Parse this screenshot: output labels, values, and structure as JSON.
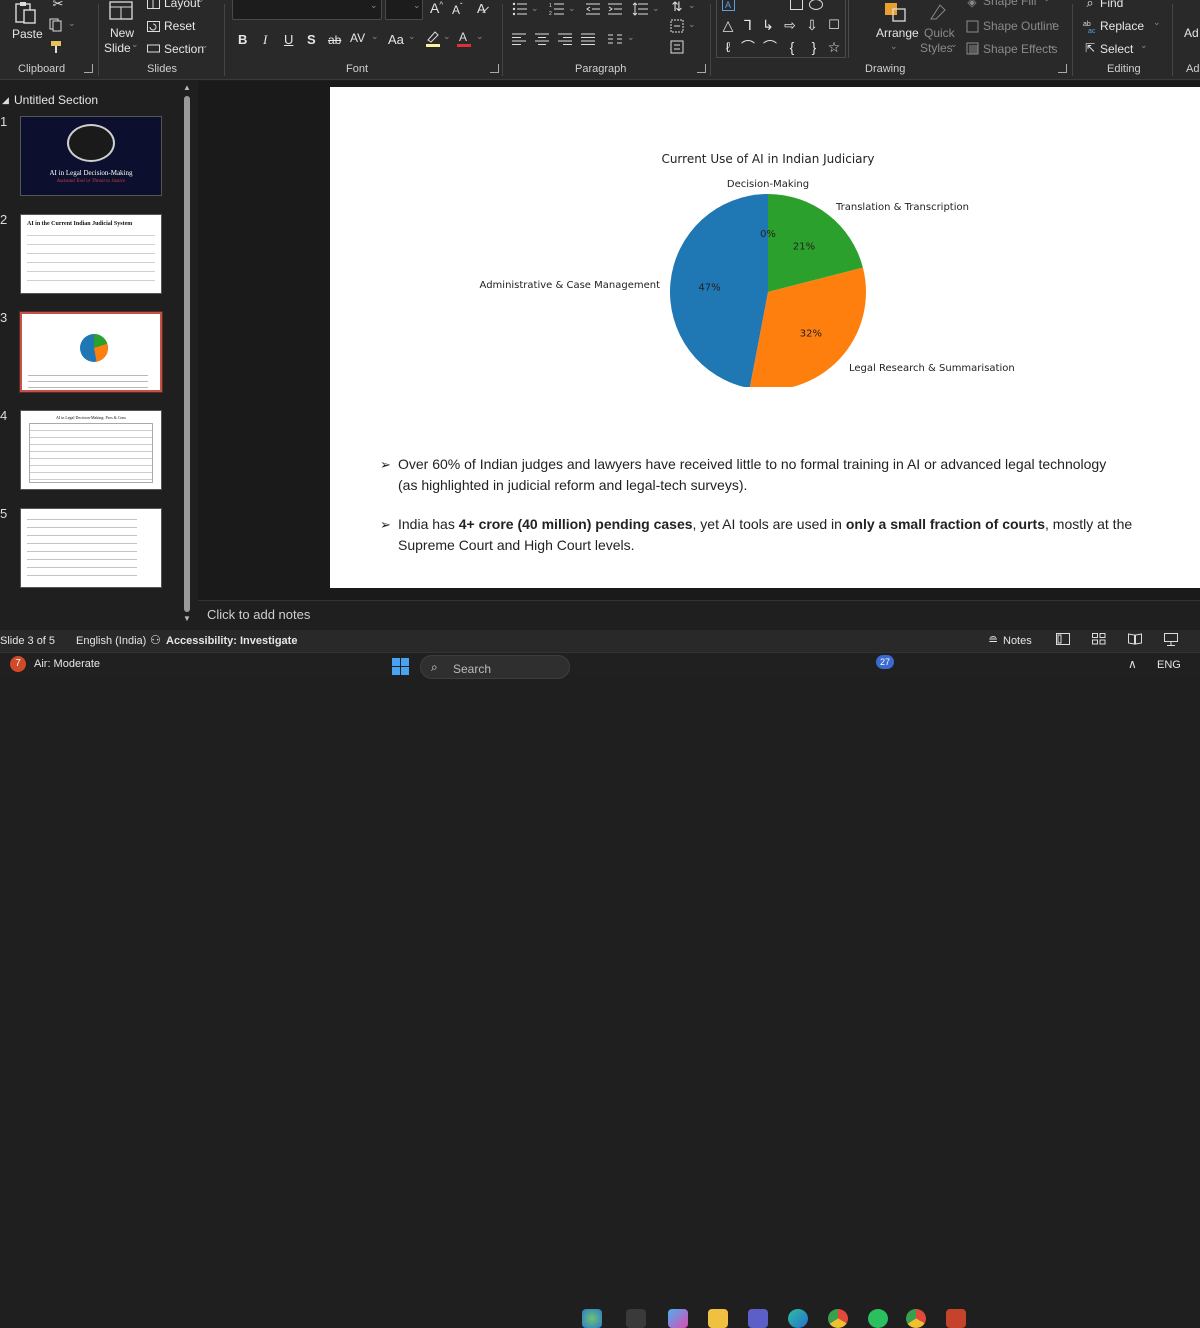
{
  "ribbon": {
    "clipboard": {
      "paste": "Paste",
      "label": "Clipboard"
    },
    "slides": {
      "layout": "Layout",
      "reset": "Reset",
      "new_slide_1": "New",
      "new_slide_2": "Slide",
      "section": "Section",
      "label": "Slides"
    },
    "font": {
      "label": "Font",
      "bold": "B",
      "italic": "I",
      "underline": "U",
      "strike": "S",
      "strike2": "ab",
      "spacing": "AV",
      "case": "Aa"
    },
    "paragraph": {
      "label": "Paragraph"
    },
    "drawing": {
      "arrange": "Arrange",
      "quick_styles_1": "Quick",
      "quick_styles_2": "Styles",
      "shape_fill": "Shape Fill",
      "shape_outline": "Shape Outline",
      "shape_effects": "Shape Effects",
      "label": "Drawing"
    },
    "editing": {
      "find": "Find",
      "replace": "Replace",
      "select": "Select",
      "label": "Editing"
    },
    "cut_off": "Ad",
    "cut_off_label": "Ad"
  },
  "thumbnails": {
    "section_title": "Untitled Section",
    "slides": [
      {
        "num": "1",
        "title": "AI in Legal Decision-Making",
        "subtitle": "Assistant Tool or Threat to Justice"
      },
      {
        "num": "2",
        "title": "AI in the Current Indian Judicial System"
      },
      {
        "num": "3"
      },
      {
        "num": "4",
        "title": "AI in Legal Decision-Making: Pros & Cons"
      },
      {
        "num": "5"
      }
    ]
  },
  "slide": {
    "bullets": [
      {
        "line1": "Over 60% of Indian judges and lawyers have received little to no formal training in AI or advanced legal technology",
        "line2": "(as highlighted in judicial reform and legal-tech surveys)."
      },
      {
        "l1a": "India has ",
        "l1b": "4+ crore (40 million) pending cases",
        "l1c": ", yet AI tools are used in ",
        "l1d": "only a small fraction of courts",
        "l1e": ", mostly at the",
        "line2": "Supreme Court and High Court levels."
      }
    ]
  },
  "chart_data": {
    "type": "pie",
    "title": "Current Use of AI in Indian Judiciary",
    "slices": [
      {
        "label": "Decision-Making",
        "value": 0,
        "pct_label": "0%",
        "color": "#d62728"
      },
      {
        "label": "Translation & Transcription",
        "value": 21,
        "pct_label": "21%",
        "color": "#2ca02c"
      },
      {
        "label": "Legal Research & Summarisation",
        "value": 32,
        "pct_label": "32%",
        "color": "#ff7f0e"
      },
      {
        "label": "Administrative & Case Management",
        "value": 47,
        "pct_label": "47%",
        "color": "#1f77b4"
      }
    ]
  },
  "notes": {
    "placeholder": "Click to add notes"
  },
  "status": {
    "slide_of": "Slide 3 of 5",
    "language": "English (India)",
    "accessibility": "Accessibility: Investigate",
    "notes_btn": "Notes"
  },
  "taskbar": {
    "weather_badge": "7",
    "weather": "Air: Moderate",
    "search": "Search",
    "badge": "27",
    "lang": "ENG"
  },
  "colors": {
    "ribbon_bg": "#292929",
    "accent": "#c4524a",
    "slide_bg": "#ffffff"
  }
}
